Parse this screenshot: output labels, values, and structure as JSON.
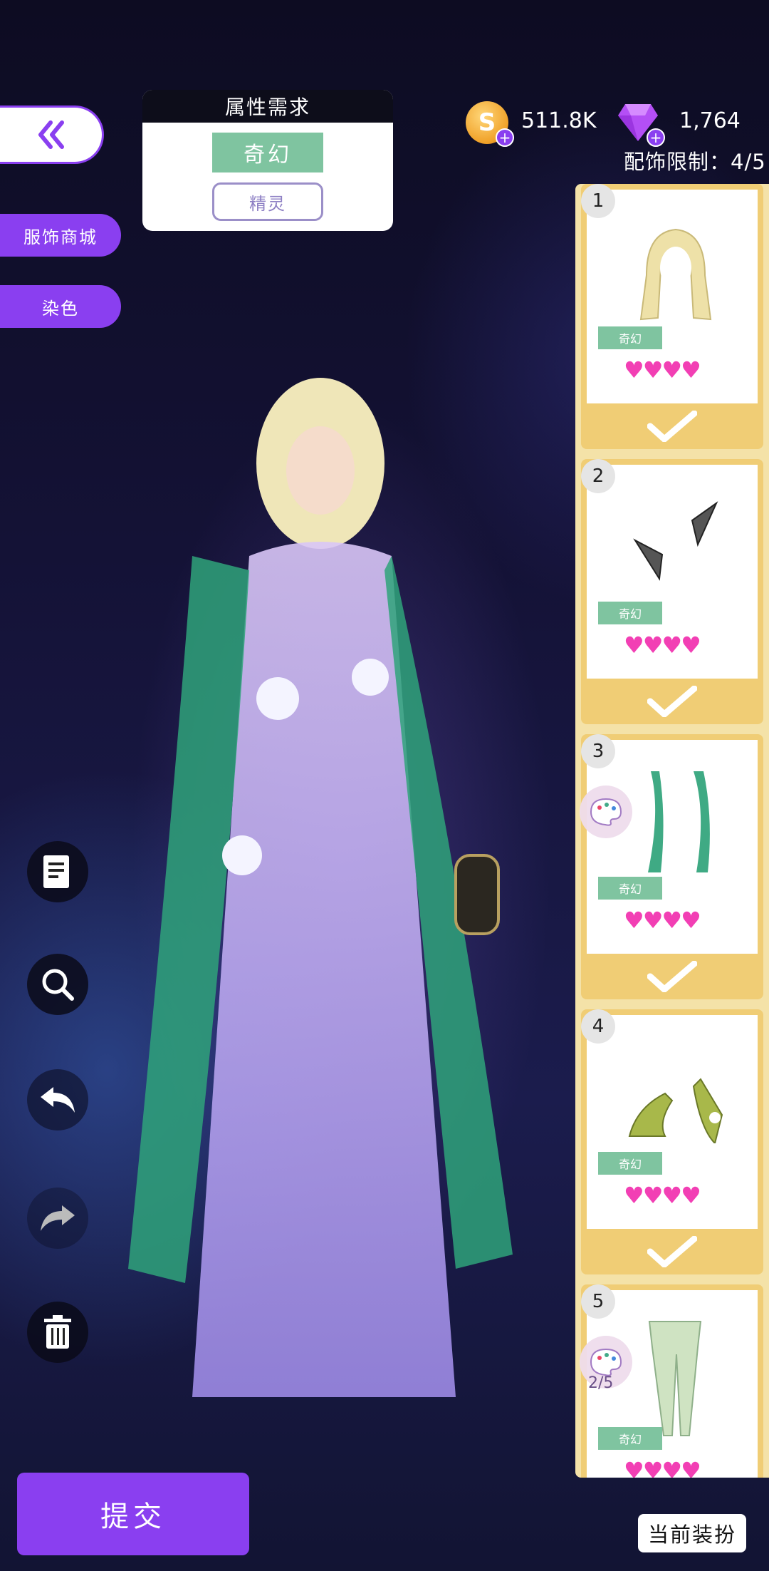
{
  "nav": {
    "back_icon": "double-chevron-left-icon"
  },
  "side_menu": {
    "shop_label": "服饰商城",
    "dye_label": "染色"
  },
  "requirement": {
    "title": "属性需求",
    "primary_tag": "奇幻",
    "secondary_tag": "精灵"
  },
  "currency": {
    "coins": "511.8K",
    "gems": "1,764"
  },
  "accessory_limit": "配饰限制：4/5",
  "items": [
    {
      "number": "1",
      "tag": "奇幻",
      "hearts": "♥♥♥♥",
      "selected": true,
      "icon": "hair-icon"
    },
    {
      "number": "2",
      "tag": "奇幻",
      "hearts": "♥♥♥♥",
      "selected": true,
      "icon": "ear-icon"
    },
    {
      "number": "3",
      "tag": "奇幻",
      "hearts": "♥♥♥♥",
      "selected": true,
      "icon": "sleeve-icon"
    },
    {
      "number": "4",
      "tag": "奇幻",
      "hearts": "♥♥♥♥",
      "selected": true,
      "icon": "shoes-icon"
    },
    {
      "number": "5",
      "tag": "奇幻",
      "hearts": "♥♥♥♥",
      "selected": false,
      "icon": "stockings-icon",
      "dye_count": "2/5"
    }
  ],
  "tools": [
    "notes-icon",
    "search-icon",
    "undo-icon",
    "redo-icon",
    "trash-icon"
  ],
  "buttons": {
    "submit": "提交",
    "current_outfit": "当前装扮"
  },
  "colors": {
    "accent": "#8a3ff0",
    "tag_green": "#7fc4a0",
    "heart": "#f23fb4",
    "panel": "#f0cd75"
  }
}
